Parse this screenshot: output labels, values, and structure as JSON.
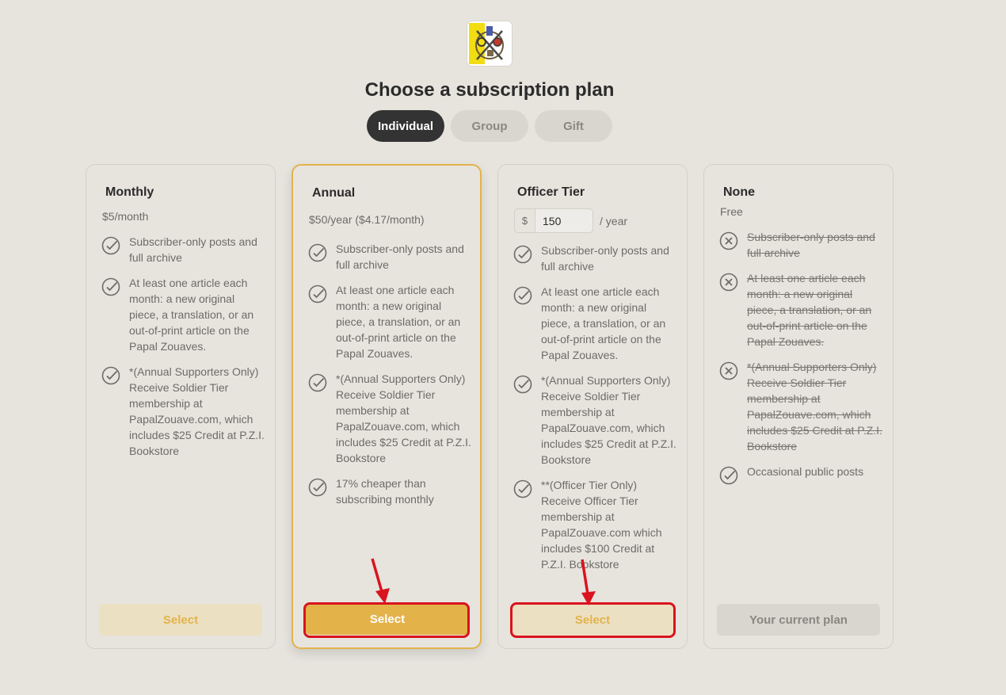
{
  "page": {
    "title": "Choose a subscription plan"
  },
  "tabs": [
    {
      "label": "Individual",
      "active": true
    },
    {
      "label": "Group",
      "active": false
    },
    {
      "label": "Gift",
      "active": false
    }
  ],
  "colors": {
    "accent": "#e3b34a",
    "dark": "#333333",
    "background": "#e7e4de",
    "annotation": "#d9141e"
  },
  "plans": {
    "monthly": {
      "name": "Monthly",
      "price": "$5/month",
      "features": [
        "Subscriber-only posts and full archive",
        "At least one article each month: a new original piece, a translation, or an out-of-print article on the Papal Zouaves.",
        "*(Annual Supporters Only) Receive Soldier Tier membership at PapalZouave.com, which includes $25 Credit at P.Z.I. Bookstore"
      ],
      "button": "Select"
    },
    "annual": {
      "name": "Annual",
      "price": "$50/year ($4.17/month)",
      "features": [
        "Subscriber-only posts and full archive",
        "At least one article each month: a new original piece, a translation, or an out-of-print article on the Papal Zouaves.",
        "*(Annual Supporters Only) Receive Soldier Tier membership at PapalZouave.com, which includes $25 Credit at P.Z.I. Bookstore",
        "17% cheaper than subscribing monthly"
      ],
      "button": "Select"
    },
    "officer": {
      "name": "Officer Tier",
      "currency": "$",
      "amount": "150",
      "period": "/ year",
      "features": [
        "Subscriber-only posts and full archive",
        "At least one article each month: a new original piece, a translation, or an out-of-print article on the Papal Zouaves.",
        "*(Annual Supporters Only) Receive Soldier Tier membership at PapalZouave.com, which includes $25 Credit at P.Z.I. Bookstore",
        "**(Officer Tier Only) Receive Officer Tier membership at PapalZouave.com which includes $100 Credit at P.Z.I. Bookstore"
      ],
      "button": "Select"
    },
    "none": {
      "name": "None",
      "price": "Free",
      "features_excluded": [
        "Subscriber-only posts and full archive",
        "At least one article each month: a new original piece, a translation, or an out-of-print article on the Papal Zouaves.",
        "*(Annual Supporters Only) Receive Soldier Tier membership at PapalZouave.com, which includes $25 Credit at P.Z.I. Bookstore"
      ],
      "features": [
        "Occasional public posts"
      ],
      "button": "Your current plan"
    }
  },
  "icons": {
    "included": "check-circle-icon",
    "excluded": "x-circle-icon"
  }
}
